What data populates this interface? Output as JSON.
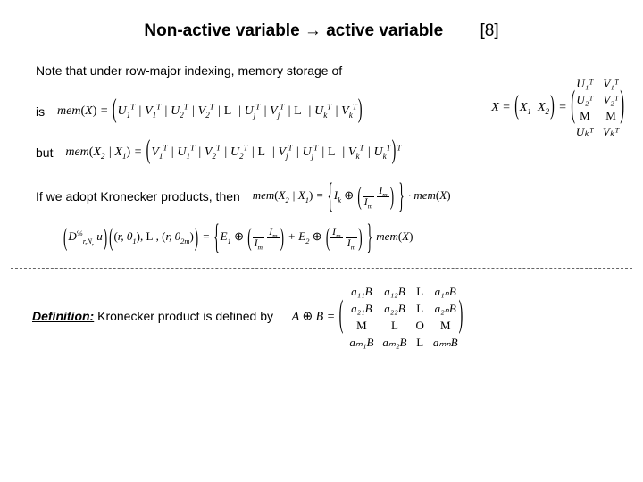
{
  "title": "Non-active variable → active variable",
  "reference": "[8]",
  "line_note": "Note that under row-major indexing, memory storage of",
  "line_is": "is",
  "line_but": "but",
  "line_kron": "If we adopt Kronecker products, then",
  "defn_head": "Definition:",
  "defn_text": " Kronecker product is defined by",
  "sym": {
    "mem": "mem",
    "X": "X",
    "X1": "X₁",
    "X2": "X₂",
    "U": "U",
    "V": "V",
    "I": "I",
    "E": "E",
    "L": "L",
    "M": "M",
    "O": "O",
    "k": "k",
    "m": "m",
    "j": "j",
    "B": "B",
    "a": "a",
    "n": "n",
    "D": "D",
    "u": "u",
    "r": "r",
    "oplus": "⊕",
    "cdot": "·"
  },
  "chart_data": {
    "type": "table",
    "title": "Kronecker product block matrix A ⊕ B",
    "rows": [
      [
        "a₁₁B",
        "a₁₂B",
        "L",
        "a₁ₙB"
      ],
      [
        "a₂₁B",
        "a₂₂B",
        "L",
        "a₂ₙB"
      ],
      [
        "M",
        "L",
        "O",
        "M"
      ],
      [
        "aₘ₁B",
        "aₘ₂B",
        "L",
        "aₘₙB"
      ]
    ]
  },
  "xmat_rows": [
    [
      "U₁ᵀ",
      "V₁ᵀ"
    ],
    [
      "U₂ᵀ",
      "V₂ᵀ"
    ],
    [
      "M",
      "M"
    ],
    [
      "Uₖᵀ",
      "Vₖᵀ"
    ]
  ]
}
